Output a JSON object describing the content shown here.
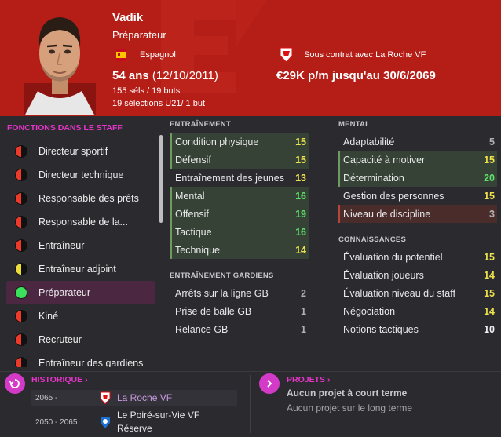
{
  "profile": {
    "name": "Vadik",
    "role": "Préparateur",
    "nationality": "Espagnol",
    "contract_status": "Sous contrat avec La Roche VF",
    "age_label": "54 ans",
    "dob": "(12/10/2011)",
    "wage": "€29K p/m jusqu'au 30/6/2069",
    "caps_goals": "155 séls / 19 buts",
    "u21_caps": "19 sélections U21/ 1 but"
  },
  "colors": {
    "header": "#b51d17",
    "accent": "#e535c8",
    "green": "#5ee06b",
    "yellow": "#eee34c"
  },
  "roles": {
    "title": "FONCTIONS DANS LE STAFF",
    "items": [
      {
        "label": "Directeur sportif",
        "status": "red"
      },
      {
        "label": "Directeur technique",
        "status": "red"
      },
      {
        "label": "Responsable des prêts",
        "status": "red"
      },
      {
        "label": "Responsable de la...",
        "status": "red"
      },
      {
        "label": "Entraîneur",
        "status": "red"
      },
      {
        "label": "Entraîneur adjoint",
        "status": "yellow"
      },
      {
        "label": "Préparateur",
        "status": "green",
        "active": true
      },
      {
        "label": "Kiné",
        "status": "red"
      },
      {
        "label": "Recruteur",
        "status": "red"
      },
      {
        "label": "Entraîneur des gardiens",
        "status": "red"
      }
    ]
  },
  "training": {
    "title": "ENTRAÎNEMENT",
    "items": [
      {
        "label": "Condition physique",
        "value": "15"
      },
      {
        "label": "Défensif",
        "value": "15"
      },
      {
        "label": "Entraînement des jeunes",
        "value": "13"
      },
      {
        "label": "Mental",
        "value": "16"
      },
      {
        "label": "Offensif",
        "value": "19"
      },
      {
        "label": "Tactique",
        "value": "16"
      },
      {
        "label": "Technique",
        "value": "14"
      }
    ]
  },
  "gk_training": {
    "title": "ENTRAÎNEMENT GARDIENS",
    "items": [
      {
        "label": "Arrêts sur la ligne GB",
        "value": "2"
      },
      {
        "label": "Prise de balle GB",
        "value": "1"
      },
      {
        "label": "Relance GB",
        "value": "1"
      }
    ]
  },
  "mental": {
    "title": "MENTAL",
    "items": [
      {
        "label": "Adaptabilité",
        "value": "5"
      },
      {
        "label": "Capacité à motiver",
        "value": "15"
      },
      {
        "label": "Détermination",
        "value": "20"
      },
      {
        "label": "Gestion des personnes",
        "value": "15"
      },
      {
        "label": "Niveau de discipline",
        "value": "3"
      }
    ]
  },
  "knowledge": {
    "title": "CONNAISSANCES",
    "items": [
      {
        "label": "Évaluation du potentiel",
        "value": "15"
      },
      {
        "label": "Évaluation joueurs",
        "value": "14"
      },
      {
        "label": "Évaluation niveau du staff",
        "value": "15"
      },
      {
        "label": "Négociation",
        "value": "14"
      },
      {
        "label": "Notions tactiques",
        "value": "10"
      }
    ]
  },
  "history": {
    "title": "HISTORIQUE",
    "rows": [
      {
        "years": "2065 -",
        "club": "La Roche VF"
      },
      {
        "years": "2050 - 2065",
        "club": "Le Poiré-sur-Vie VF",
        "club2": "Réserve"
      }
    ]
  },
  "projects": {
    "title": "PROJETS",
    "short_term": "Aucun projet à court terme",
    "long_term": "Aucun projet sur le long terme"
  }
}
